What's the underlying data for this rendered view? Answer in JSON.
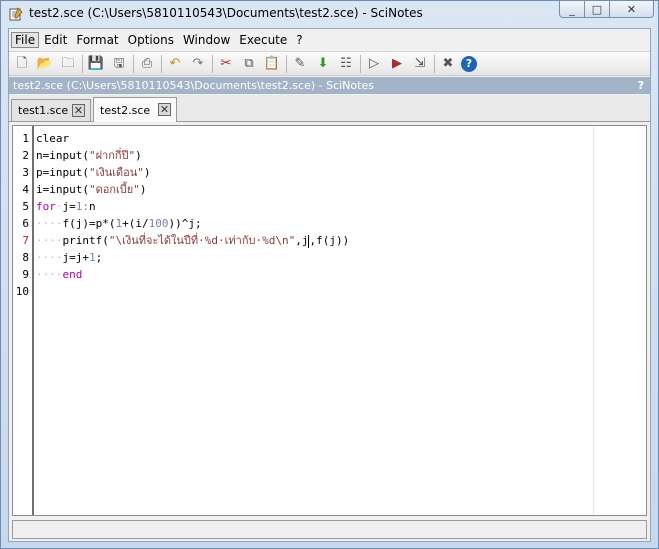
{
  "window": {
    "title": "test2.sce (C:\\Users\\5810110543\\Documents\\test2.sce) - SciNotes",
    "min_label": "_",
    "max_label": "□",
    "close_label": "✕"
  },
  "menu": [
    {
      "label": "File",
      "key": "file"
    },
    {
      "label": "Edit",
      "key": "edit"
    },
    {
      "label": "Format",
      "key": "format"
    },
    {
      "label": "Options",
      "key": "options"
    },
    {
      "label": "Window",
      "key": "window"
    },
    {
      "label": "Execute",
      "key": "execute"
    },
    {
      "label": "?",
      "key": "help"
    }
  ],
  "toolbar": [
    {
      "icon": "new-file-icon",
      "glyph": "🗋"
    },
    {
      "icon": "open-folder-icon",
      "glyph": "📂"
    },
    {
      "icon": "open-recent-icon",
      "glyph": "🗀"
    },
    {
      "sep": true
    },
    {
      "icon": "save-icon",
      "glyph": "💾"
    },
    {
      "icon": "save-as-icon",
      "glyph": "🖫"
    },
    {
      "sep": true
    },
    {
      "icon": "print-icon",
      "glyph": "⎙"
    },
    {
      "sep": true
    },
    {
      "icon": "undo-icon",
      "glyph": "↶"
    },
    {
      "icon": "redo-icon",
      "glyph": "↷"
    },
    {
      "sep": true
    },
    {
      "icon": "cut-icon",
      "glyph": "✂"
    },
    {
      "icon": "copy-icon",
      "glyph": "⧉"
    },
    {
      "icon": "paste-icon",
      "glyph": "📋"
    },
    {
      "sep": true
    },
    {
      "icon": "find-replace-icon",
      "glyph": "✎"
    },
    {
      "icon": "load-into-scilab-icon",
      "glyph": "⬇"
    },
    {
      "icon": "execute-file-icon",
      "glyph": "☷"
    },
    {
      "sep": true
    },
    {
      "icon": "run-icon",
      "glyph": "▷"
    },
    {
      "icon": "run-with-echo-icon",
      "glyph": "▶"
    },
    {
      "icon": "run-until-caret-icon",
      "glyph": "⇲"
    },
    {
      "sep": true
    },
    {
      "icon": "settings-icon",
      "glyph": "✖"
    },
    {
      "icon": "help-icon",
      "glyph": "?"
    }
  ],
  "doc_header": {
    "text": "test2.sce (C:\\Users\\5810110543\\Documents\\test2.sce) - SciNotes",
    "help": "?"
  },
  "tabs": [
    {
      "label": "test1.sce",
      "active": false
    },
    {
      "label": "test2.sce",
      "active": true
    }
  ],
  "editor": {
    "active_line": 7,
    "line_numbers": [
      "1",
      "2",
      "3",
      "4",
      "5",
      "6",
      "7",
      "8",
      "9",
      "10"
    ],
    "lines": [
      "clear",
      "n=input(\"ฝากกี่ปี\")",
      "p=input(\"เงินเดือน\")",
      "i=input(\"ดอกเบี้ย\")",
      "for j=1:n",
      "    f(j)=p*(1+(i/100))^j;",
      "    printf(\"\\เงินที่จะได้ในปีที่ %d เท่ากับ %d\\n\",j,f(j))",
      "    j=j+1;",
      "    end",
      ""
    ]
  },
  "colors": {
    "keyword": "#b000b0",
    "string": "#8b3a3a",
    "number": "#7d7daf",
    "whitespace_marker": "#bfbfbf",
    "header_bg": "#a4b4c8"
  }
}
